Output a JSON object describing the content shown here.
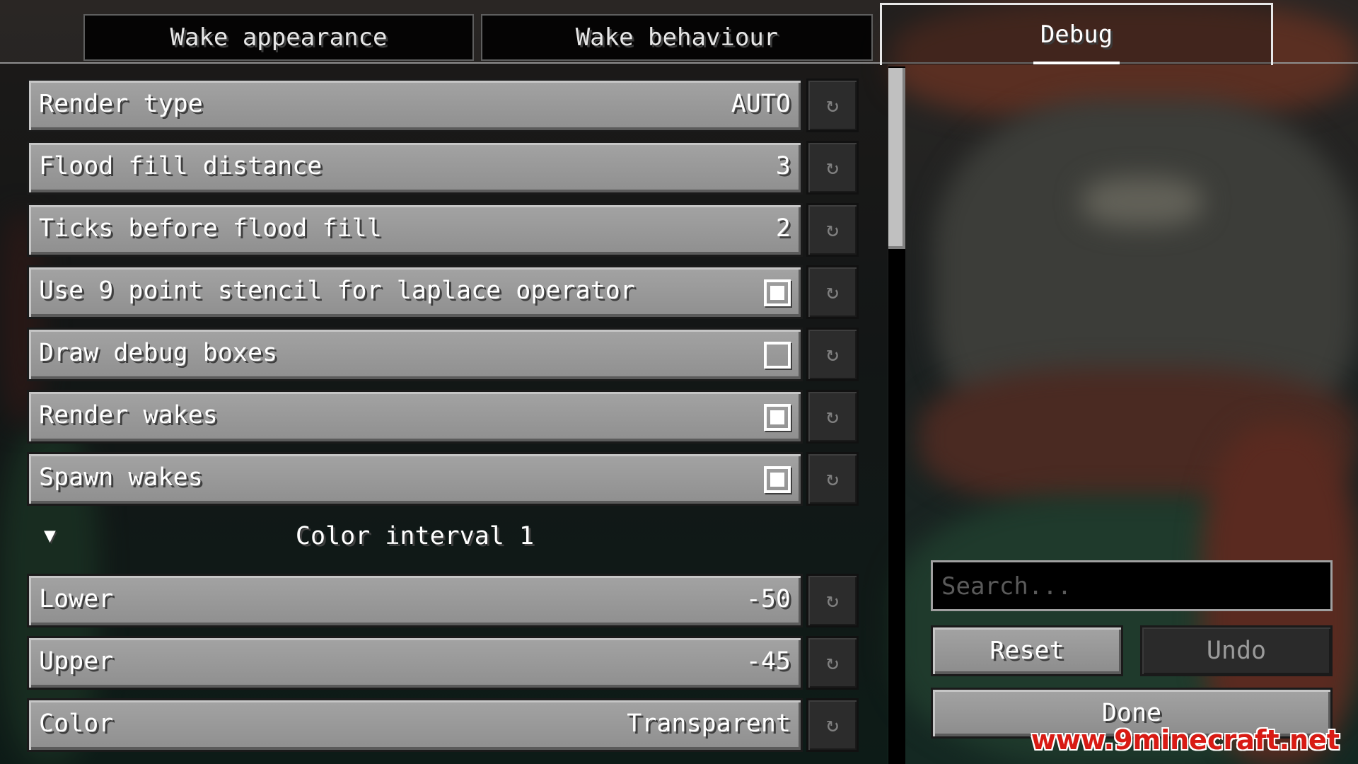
{
  "tabs": [
    {
      "label": "Wake appearance",
      "active": false
    },
    {
      "label": "Wake behaviour",
      "active": false
    },
    {
      "label": "Debug",
      "active": true
    }
  ],
  "options": [
    {
      "label": "Render type",
      "value": "AUTO"
    },
    {
      "label": "Flood fill distance",
      "value": "3"
    },
    {
      "label": "Ticks before flood fill",
      "value": "2"
    },
    {
      "label": "Use 9 point stencil for laplace operator",
      "checked": true
    },
    {
      "label": "Draw debug boxes",
      "checked": false
    },
    {
      "label": "Render wakes",
      "checked": true
    },
    {
      "label": "Spawn wakes",
      "checked": true
    }
  ],
  "group": {
    "toggle_glyph": "▼",
    "title": "Color interval 1",
    "options": [
      {
        "label": "Lower",
        "value": "-50"
      },
      {
        "label": "Upper",
        "value": "-45"
      },
      {
        "label": "Color",
        "value": "Transparent"
      }
    ]
  },
  "reset_glyph": "↻",
  "search": {
    "placeholder": "Search..."
  },
  "buttons": {
    "reset": "Reset",
    "undo": "Undo",
    "done": "Done"
  },
  "watermark": "www.9minecraft.net"
}
